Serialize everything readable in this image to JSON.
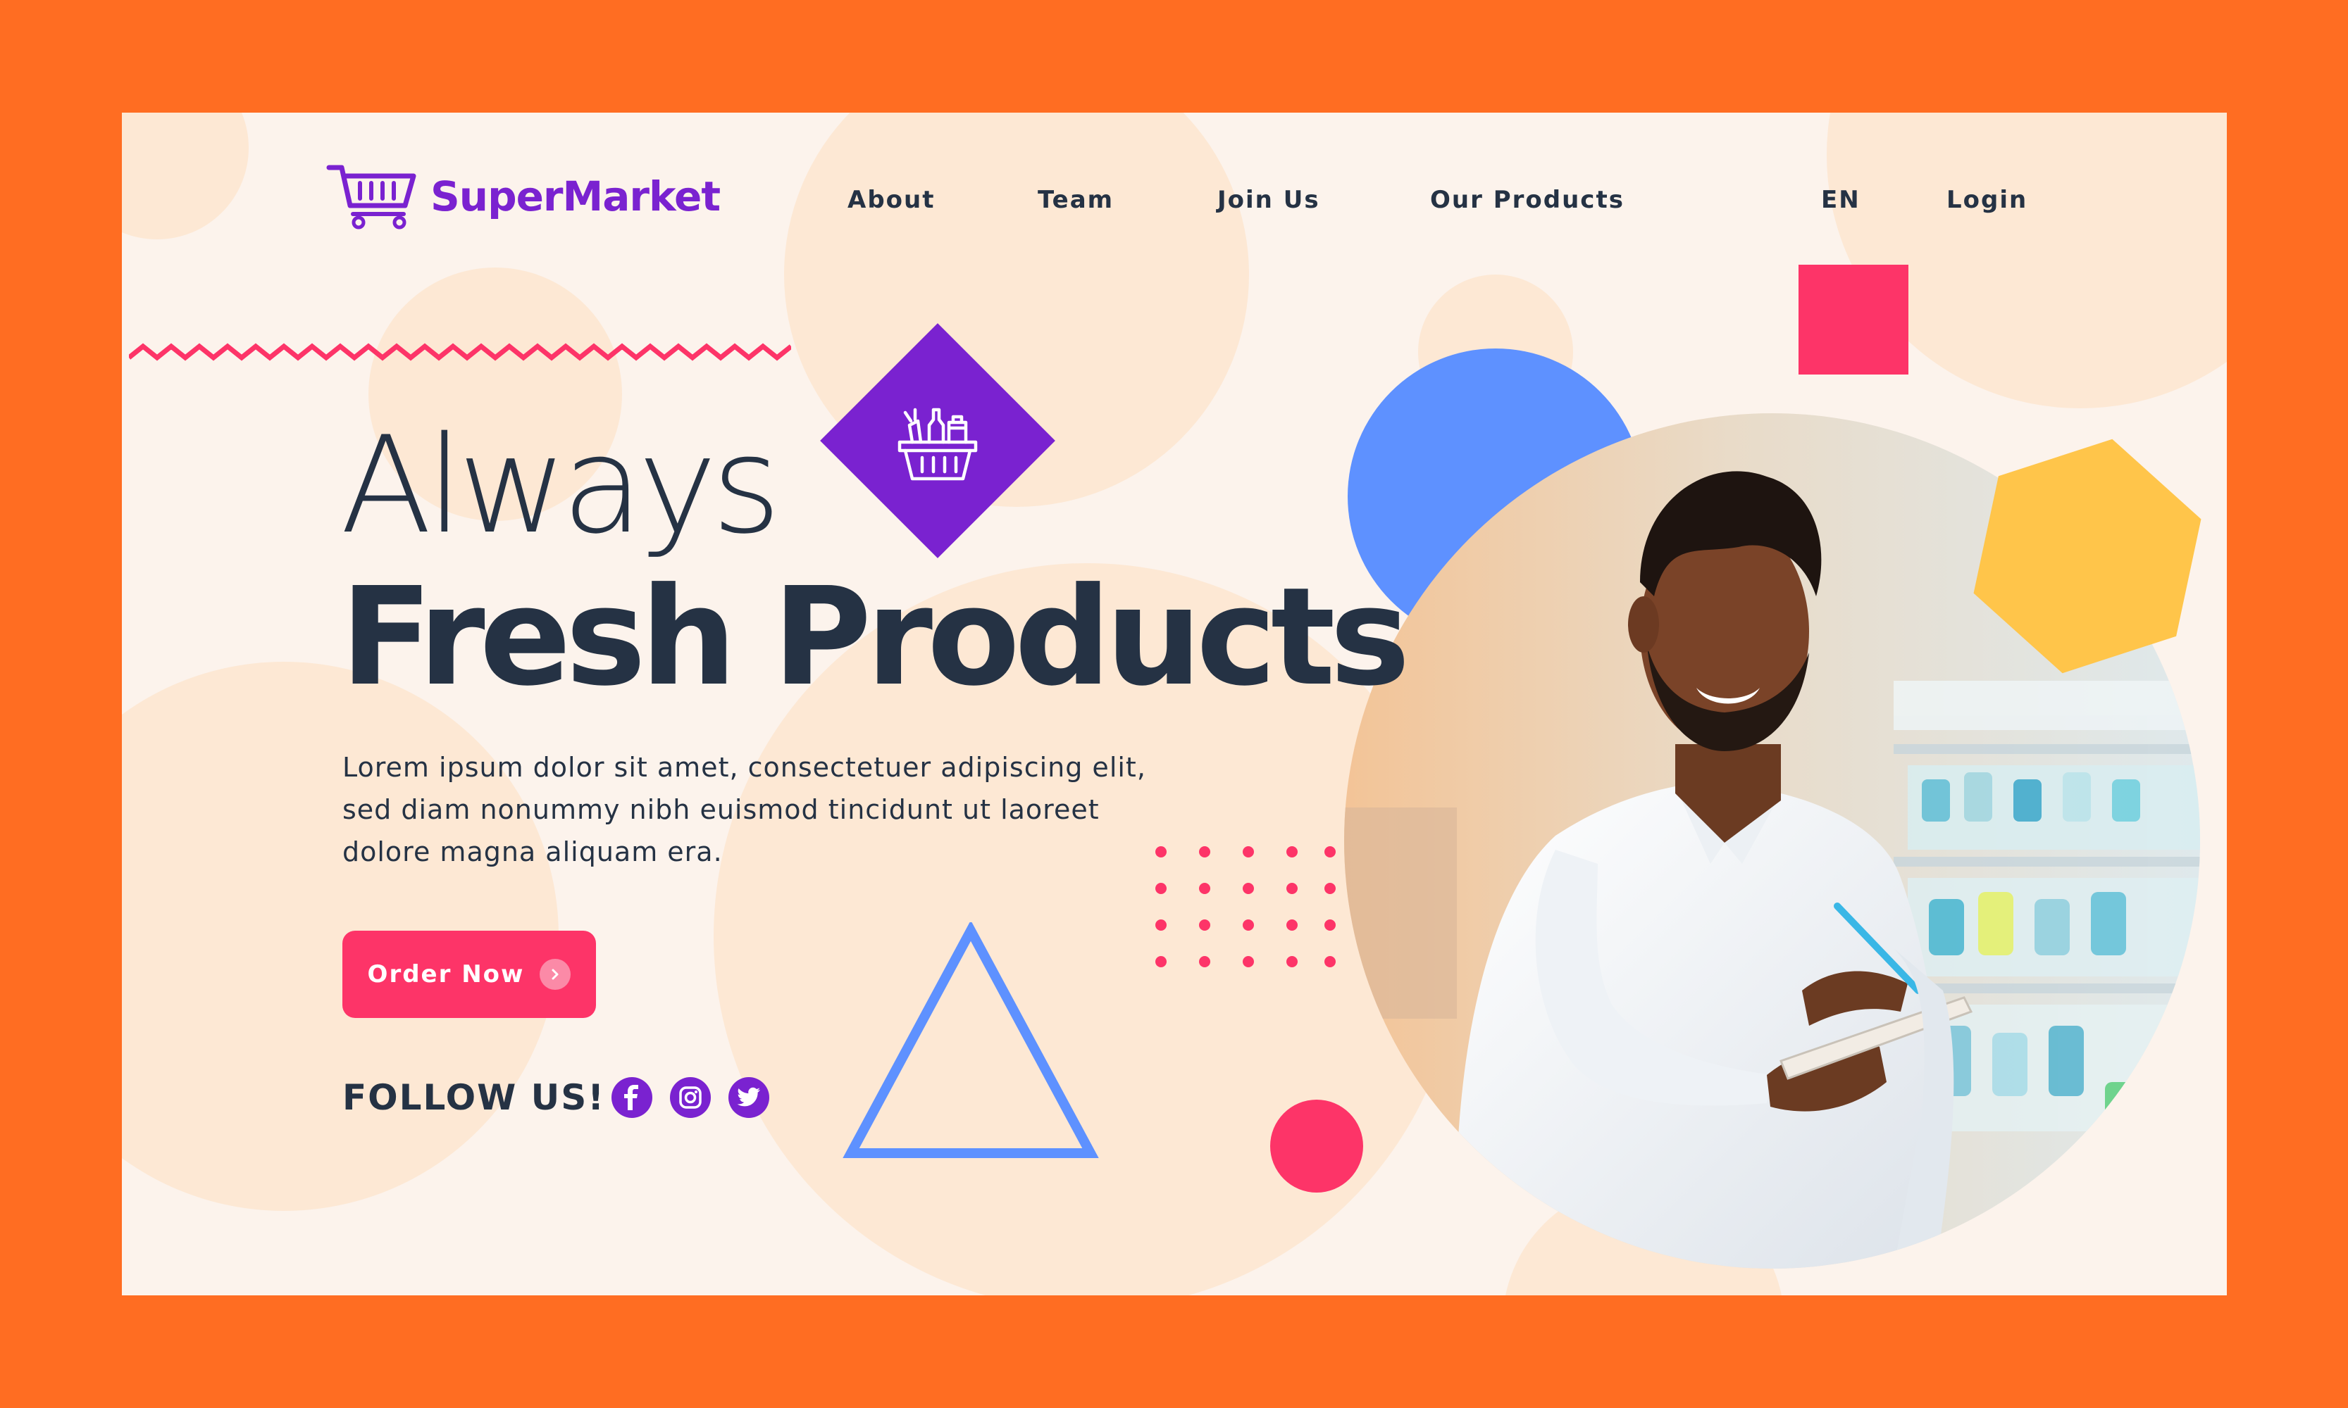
{
  "brand": {
    "name": "SuperMarket"
  },
  "nav": {
    "items": [
      "About",
      "Team",
      "Join Us",
      "Our Products"
    ],
    "language": "EN",
    "login": "Login"
  },
  "hero": {
    "headline_light": "Always",
    "headline_bold": "Fresh Products",
    "description": "Lorem ipsum dolor sit amet, consectetuer adipiscing elit, sed diam nonummy nibh euismod tincidunt ut laoreet dolore magna aliquam era.",
    "cta": "Order Now",
    "follow_label": "FOLLOW US!"
  },
  "social_icons": [
    "facebook-icon",
    "instagram-icon",
    "twitter-icon"
  ],
  "colors": {
    "frame": "#ff6d22",
    "background": "#fcf3ec",
    "brand_purple": "#7a22d0",
    "accent_pink": "#fd3468",
    "accent_blue": "#5e91ff",
    "accent_yellow": "#ffc54a",
    "text_dark": "#253244"
  }
}
